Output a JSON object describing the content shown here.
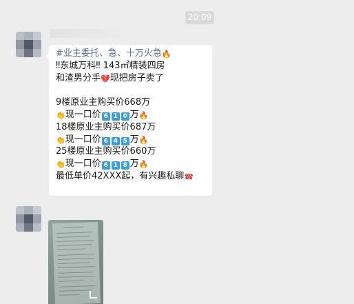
{
  "chat": {
    "timestamp": "20:09",
    "message": {
      "lines": [
        {
          "parts": [
            {
              "t": "text",
              "v": "#业主委托、急、十万火急",
              "cls": "hashtag"
            },
            {
              "t": "emoji",
              "v": "🔥",
              "cls": "fire",
              "name": "fire-icon"
            }
          ]
        },
        {
          "parts": [
            {
              "t": "text",
              "v": "‼东城万科‼ 143㎡精装四房"
            }
          ]
        },
        {
          "parts": [
            {
              "t": "text",
              "v": "和渣男分手"
            },
            {
              "t": "emoji",
              "v": "💔",
              "cls": "heart",
              "name": "broken-heart-icon"
            },
            {
              "t": "text",
              "v": "现把房子卖了"
            }
          ]
        },
        {
          "parts": []
        },
        {
          "parts": [
            {
              "t": "text",
              "v": "9楼原业主购买价668万"
            }
          ]
        },
        {
          "parts": [
            {
              "t": "text",
              "v": "  "
            },
            {
              "t": "emoji",
              "v": "👏",
              "cls": "clap",
              "name": "clapping-hands-icon"
            },
            {
              "t": "text",
              "v": "现一口价"
            },
            {
              "t": "key",
              "v": "6"
            },
            {
              "t": "key",
              "v": "1"
            },
            {
              "t": "key",
              "v": "0"
            },
            {
              "t": "text",
              "v": "万"
            },
            {
              "t": "emoji",
              "v": "🔥",
              "cls": "fire",
              "name": "fire-icon"
            }
          ]
        },
        {
          "parts": [
            {
              "t": "text",
              "v": "18楼原业主购买价687万"
            }
          ]
        },
        {
          "parts": [
            {
              "t": "emoji",
              "v": "👏",
              "cls": "clap",
              "name": "clapping-hands-icon"
            },
            {
              "t": "text",
              "v": "现一口价"
            },
            {
              "t": "key",
              "v": "6"
            },
            {
              "t": "key",
              "v": "4"
            },
            {
              "t": "key",
              "v": "5"
            },
            {
              "t": "text",
              "v": "万"
            },
            {
              "t": "emoji",
              "v": "🔥",
              "cls": "fire",
              "name": "fire-icon"
            }
          ]
        },
        {
          "parts": [
            {
              "t": "text",
              "v": "25楼原业主购买价660万"
            }
          ]
        },
        {
          "parts": [
            {
              "t": "emoji",
              "v": "👏",
              "cls": "clap",
              "name": "clapping-hands-icon"
            },
            {
              "t": "text",
              "v": "现一口价"
            },
            {
              "t": "key",
              "v": "6"
            },
            {
              "t": "key",
              "v": "1"
            },
            {
              "t": "key",
              "v": "8"
            },
            {
              "t": "text",
              "v": "万"
            },
            {
              "t": "emoji",
              "v": "🔥",
              "cls": "fire",
              "name": "fire-icon"
            }
          ]
        },
        {
          "parts": [
            {
              "t": "text",
              "v": "最低单价42XXX起，有兴趣私聊"
            },
            {
              "t": "emoji",
              "v": "☎",
              "cls": "phone",
              "name": "telephone-icon"
            }
          ]
        }
      ]
    },
    "image_message": {
      "icon": "expand-corner-icon"
    }
  },
  "colors": {
    "background": "#ededed",
    "bubble": "#ffffff",
    "hashtag": "#576b95",
    "keycap": "#3a9de0"
  }
}
